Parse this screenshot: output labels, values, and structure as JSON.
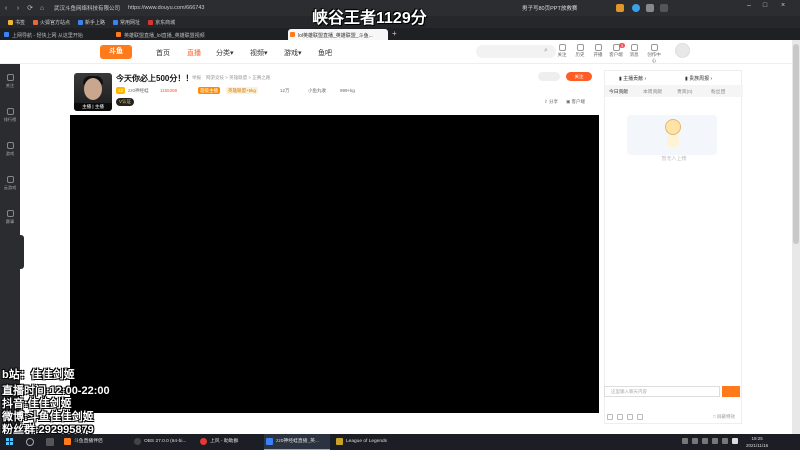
{
  "browser": {
    "site_info": "武汉斗鱼网络科技有限公司",
    "url": "https://www.douyu.com/666743",
    "tab_title": "男子写80页PPT放救赛",
    "bookmarks": [
      "书签",
      "火狐官方站点",
      "新手上路",
      "常用网址",
      "京东商城"
    ],
    "tabs": [
      "上网导航 - 轻快上网 从这里开始",
      "英雄联盟直播_lol直播_英雄联盟视频",
      "lol英雄联盟直播_英雄联盟_斗鱼..."
    ],
    "new_tab": "+"
  },
  "douyu": {
    "logo": "斗鱼",
    "nav": [
      "首页",
      "直播",
      "分类",
      "视频",
      "游戏",
      "鱼吧"
    ],
    "header_icons": [
      "关注",
      "历史",
      "开播",
      "客户端",
      "消息",
      "创作中心"
    ],
    "message_badge": "3"
  },
  "sidebar": {
    "items": [
      "关注",
      "排行榜",
      "游戏",
      "云游戏",
      "赛事"
    ]
  },
  "room": {
    "avatar_caption": "主播 | 主播",
    "title": "今天你必上500分！！",
    "report": "举报",
    "breadcrumb": "网游竞技 > 英雄联盟 > 正赛之路",
    "level_chip": "22",
    "streamer": "zz0神经蛙",
    "hot": "1155398",
    "chip_orange": "超级主播",
    "chip_yellow": "英雄联盟+5kg",
    "fans": "12万",
    "fish_gift": "小鱼丸收",
    "weight": "999+kg",
    "v_badge": "V认证",
    "follow": "关注",
    "share": "分享",
    "client": "客户端"
  },
  "panel": {
    "rank_title": "主播贡献",
    "noble_title": "贵族周报",
    "tabs": [
      "今日贡献",
      "本周贡献",
      "贵宾(0)",
      "粉丝团"
    ],
    "empty_caption": "暂无人上榜",
    "shield_label": "屏蔽特效",
    "chat_placeholder": "这里输入聊天内容"
  },
  "overlay": {
    "title": "峡谷王者1129分",
    "lines": [
      {
        "k": "b站：",
        "v": "佳佳剑姬"
      },
      {
        "k": "直播时间:",
        "v": "12:00-22:00"
      },
      {
        "k": "抖音:",
        "v": "佳佳剑姬"
      },
      {
        "k": "微博:",
        "v": "斗鱼佳佳剑姬"
      },
      {
        "k": "粉丝群:",
        "v": "292995879"
      }
    ]
  },
  "taskbar": {
    "apps": [
      "斗鱼直播伴侣",
      "OBS 27.0.0 (64-bi...",
      "上风 - 助助群",
      "zz0神经蛙直播_英...",
      "League of Legends"
    ],
    "time": "19:25",
    "date": "2021/11/16"
  },
  "colors": {
    "accent": "#ff5d23",
    "logo": "#ff7a1a",
    "chrome": "#2b2d31"
  }
}
